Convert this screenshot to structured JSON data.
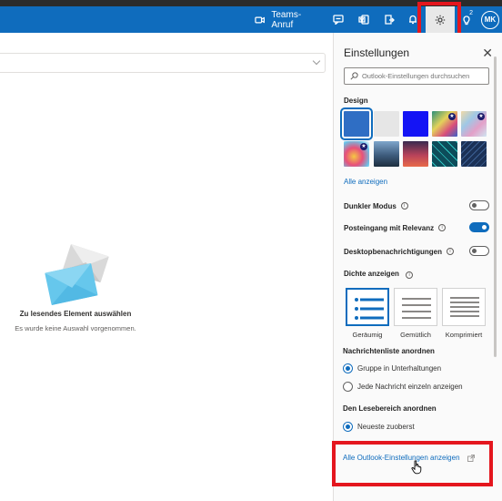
{
  "topbar": {
    "teams_label": "Teams-Anruf",
    "avatar_initials": "MK",
    "notification_count": "2"
  },
  "reading_pane": {
    "empty_title": "Zu lesendes Element auswählen",
    "empty_subtitle": "Es wurde keine Auswahl vorgenommen."
  },
  "settings": {
    "title": "Einstellungen",
    "search_placeholder": "Outlook-Einstellungen durchsuchen",
    "design_header": "Design",
    "show_all_link": "Alle anzeigen",
    "toggles": [
      {
        "label": "Dunkler Modus",
        "on": false
      },
      {
        "label": "Posteingang mit Relevanz",
        "on": true
      },
      {
        "label": "Desktopbenachrichtigungen",
        "on": false
      }
    ],
    "density_header": "Dichte anzeigen",
    "density_options": [
      "Geräumig",
      "Gemütlich",
      "Komprimiert"
    ],
    "density_selected": "Geräumig",
    "message_list_header": "Nachrichtenliste anordnen",
    "message_list_options": [
      "Gruppe in Unterhaltungen",
      "Jede Nachricht einzeln anzeigen"
    ],
    "message_list_selected": "Gruppe in Unterhaltungen",
    "reading_pane_header": "Den Lesebereich anordnen",
    "reading_pane_options": [
      "Neueste zuoberst"
    ],
    "reading_pane_selected": "Neueste zuoberst",
    "all_settings_link": "Alle Outlook-Einstellungen anzeigen"
  },
  "colors": {
    "brand": "#0f6cbd",
    "highlight": "#e4161e"
  }
}
